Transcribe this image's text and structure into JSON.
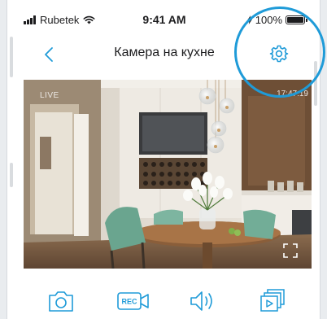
{
  "status_bar": {
    "carrier": "Rubetek",
    "time": "9:41 AM",
    "battery_text": "100%",
    "battery_level": 1.0
  },
  "nav": {
    "title": "Камера на кухне",
    "back_icon": "chevron-left-icon",
    "settings_icon": "gear-icon"
  },
  "camera": {
    "live_label": "LIVE",
    "timestamp": "17:47:19"
  },
  "toolbar": {
    "snapshot_icon": "camera-icon",
    "record_label": "REC",
    "sound_icon": "speaker-icon",
    "archive_icon": "archive-icon"
  },
  "colors": {
    "accent": "#1f9bd8",
    "text": "#1c1c1e",
    "background": "#ffffff"
  }
}
